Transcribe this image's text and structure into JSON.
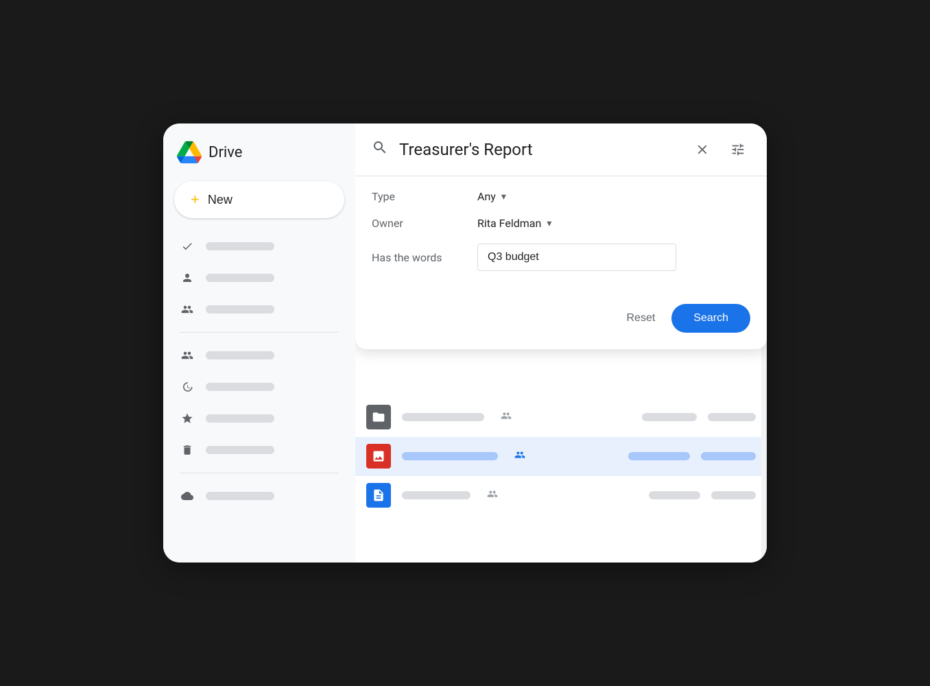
{
  "app": {
    "title": "Drive",
    "background": "#1a1a1a"
  },
  "sidebar": {
    "new_button_label": "New",
    "nav_items": [
      {
        "id": "home",
        "icon": "✓",
        "label": ""
      },
      {
        "id": "profile",
        "icon": "👤",
        "label": ""
      },
      {
        "id": "team",
        "icon": "👥",
        "label": ""
      },
      {
        "id": "shared",
        "icon": "👥",
        "label": ""
      },
      {
        "id": "recent",
        "icon": "🕐",
        "label": ""
      },
      {
        "id": "starred",
        "icon": "☆",
        "label": ""
      },
      {
        "id": "trash",
        "icon": "🗑",
        "label": ""
      },
      {
        "id": "storage",
        "icon": "☁",
        "label": ""
      }
    ]
  },
  "search_modal": {
    "query": "Treasurer's Report",
    "close_label": "×",
    "filter_icon_label": "≡",
    "type_label": "Type",
    "type_value": "Any",
    "owner_label": "Owner",
    "owner_value": "Rita Feldman",
    "has_words_label": "Has the words",
    "has_words_value": "Q3 budget",
    "reset_label": "Reset",
    "search_label": "Search"
  },
  "file_list": {
    "rows": [
      {
        "type": "folder",
        "highlighted": false,
        "name_width": 120,
        "date_width": 80,
        "size_width": 70
      },
      {
        "type": "image",
        "highlighted": true,
        "name_width": 140,
        "date_width": 90,
        "size_width": 80
      },
      {
        "type": "doc",
        "highlighted": false,
        "name_width": 100,
        "date_width": 75,
        "size_width": 65
      }
    ]
  }
}
